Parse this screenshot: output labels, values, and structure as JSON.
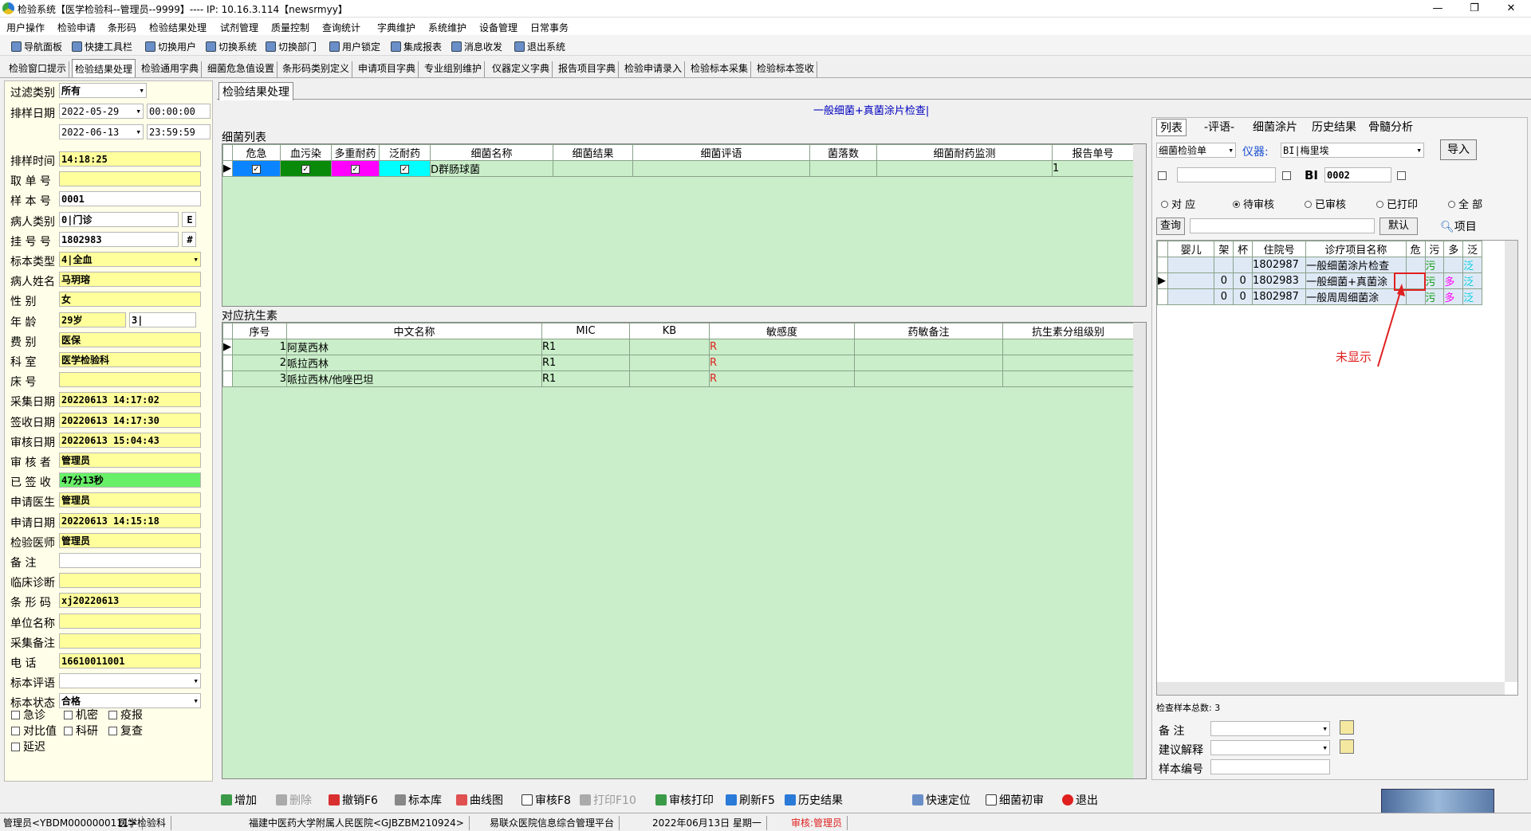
{
  "window": {
    "title": "检验系统【医学检验科--管理员--9999】---- IP: 10.16.3.114【newsrmyy】",
    "minimize": "—",
    "restore": "❐",
    "close": "✕"
  },
  "menu": [
    "用户操作",
    "检验申请",
    "条形码",
    "检验结果处理",
    "试剂管理",
    "质量控制",
    "查询统计",
    "字典维护",
    "系统维护",
    "设备管理",
    "日常事务"
  ],
  "toolbar": [
    "导航面板",
    "快捷工具栏",
    "切换用户",
    "切换系统",
    "切换部门",
    "用户锁定",
    "集成报表",
    "消息收发",
    "退出系统"
  ],
  "tabs": [
    "检验窗口提示",
    "检验结果处理",
    "检验通用字典",
    "细菌危急值设置",
    "条形码类别定义",
    "申请项目字典",
    "专业组别维护",
    "仪器定义字典",
    "报告项目字典",
    "检验申请录入",
    "检验标本采集",
    "检验标本签收"
  ],
  "active_tab": "检验结果处理",
  "left": {
    "filter_label": "过滤类别",
    "filter_value": "所有",
    "date_label": "排样日期",
    "date_from": "2022-05-29",
    "time_from": "00:00:00",
    "date_to": "2022-06-13",
    "time_to": "23:59:59",
    "fields": [
      {
        "label": "排样时间",
        "value": "14:18:25",
        "style": "y"
      },
      {
        "label": "取 单 号",
        "value": "",
        "style": "y"
      },
      {
        "label": "样 本 号",
        "value": "0001",
        "style": "w"
      },
      {
        "label": "病人类别",
        "value": "0|门诊",
        "style": "w",
        "btn": "E"
      },
      {
        "label": "挂 号 号",
        "value": "1802983",
        "style": "w",
        "btn": "#"
      },
      {
        "label": "标本类型",
        "value": "4|全血",
        "style": "y",
        "dd": true
      },
      {
        "label": "病人姓名",
        "value": "马玥瑢",
        "style": "y"
      },
      {
        "label": "性    别",
        "value": "女",
        "style": "y"
      },
      {
        "label": "年    龄",
        "value": "29岁",
        "style": "y",
        "extra": "3|"
      },
      {
        "label": "费    别",
        "value": "医保",
        "style": "y"
      },
      {
        "label": "科    室",
        "value": "医学检验科",
        "style": "y"
      },
      {
        "label": "床    号",
        "value": "",
        "style": "y"
      },
      {
        "label": "采集日期",
        "value": "20220613 14:17:02",
        "style": "y"
      },
      {
        "label": "签收日期",
        "value": "20220613 14:17:30",
        "style": "y"
      },
      {
        "label": "审核日期",
        "value": "20220613 15:04:43",
        "style": "y"
      },
      {
        "label": "审 核 者",
        "value": "管理员",
        "style": "y"
      },
      {
        "label": "已 签 收",
        "value": "47分13秒",
        "style": "g"
      },
      {
        "label": "申请医生",
        "value": "管理员",
        "style": "y"
      },
      {
        "label": "申请日期",
        "value": "20220613 14:15:18",
        "style": "y"
      },
      {
        "label": "检验医师",
        "value": "管理员",
        "style": "y"
      },
      {
        "label": "备    注",
        "value": "",
        "style": "w"
      },
      {
        "label": "临床诊断",
        "value": "",
        "style": "y"
      },
      {
        "label": "条 形 码",
        "value": "xj20220613",
        "style": "y"
      },
      {
        "label": "单位名称",
        "value": "",
        "style": "y"
      },
      {
        "label": "采集备注",
        "value": "",
        "style": "y"
      },
      {
        "label": "电    话",
        "value": "16610011001",
        "style": "y"
      },
      {
        "label": "标本评语",
        "value": "",
        "style": "w",
        "dd": true
      },
      {
        "label": "标本状态",
        "value": "合格",
        "style": "w",
        "dd": true
      }
    ],
    "checks": [
      "急诊",
      "机密",
      "疫报",
      "对比值",
      "科研",
      "复查",
      "延迟"
    ]
  },
  "center": {
    "header_tab": "检验结果处理",
    "test_name": "一般细菌+真菌涂片检查|",
    "bact_title": "细菌列表",
    "bact_cols": [
      "危急",
      "血污染",
      "多重耐药",
      "泛耐药",
      "细菌名称",
      "细菌结果",
      "细菌评语",
      "菌落数",
      "细菌耐药监测",
      "报告单号"
    ],
    "bact_rows": [
      {
        "name": "D群肠球菌",
        "result": "",
        "comment": "",
        "count": "",
        "monitor": "",
        "report": "1",
        "flags": [
          "✓",
          "✓",
          "✓",
          "✓"
        ]
      }
    ],
    "abx_title": "对应抗生素",
    "abx_cols": [
      "序号",
      "中文名称",
      "MIC",
      "KB",
      "敏感度",
      "药敏备注",
      "抗生素分组级别"
    ],
    "abx_rows": [
      {
        "no": "1",
        "name": "阿莫西林",
        "mic": "R1",
        "kb": "",
        "sens": "R"
      },
      {
        "no": "2",
        "name": "哌拉西林",
        "mic": "R1",
        "kb": "",
        "sens": "R"
      },
      {
        "no": "3",
        "name": "哌拉西林/他唑巴坦",
        "mic": "R1",
        "kb": "",
        "sens": "R"
      }
    ]
  },
  "right": {
    "tabs": [
      "列表",
      "-评语-",
      "细菌涂片",
      "历史结果",
      "骨髓分析"
    ],
    "doc_type": "细菌检验单",
    "instrument_label": "仪器:",
    "instrument": "BI|梅里埃",
    "import": "导入",
    "bi_label": "BI",
    "bi_value": "0002",
    "radios": [
      "对 应",
      "待审核",
      "已审核",
      "已打印",
      "全 部"
    ],
    "query": "查询",
    "default": "默认",
    "item": "项目",
    "cols": [
      "婴儿",
      "架",
      "杯",
      "住院号",
      "诊疗项目名称",
      "危",
      "污",
      "多",
      "泛"
    ],
    "rows": [
      {
        "infant": "",
        "rack": "",
        "cup": "",
        "id": "1802987",
        "item": "一般细菌涂片检查",
        "w": "",
        "p": "污",
        "m": "",
        "f": "泛"
      },
      {
        "infant": "",
        "rack": "0",
        "cup": "0",
        "id": "1802983",
        "item": "一般细菌+真菌涂",
        "w": "",
        "p": "污",
        "m": "多",
        "f": "泛"
      },
      {
        "infant": "",
        "rack": "0",
        "cup": "0",
        "id": "1802987",
        "item": "一般周周细菌涂",
        "w": "",
        "p": "污",
        "m": "多",
        "f": "泛"
      }
    ],
    "annotation": "未显示",
    "total": "检查样本总数: 3",
    "remark": "备    注",
    "advice": "建议解释",
    "sample_no": "样本编号"
  },
  "bottom": [
    "增加",
    "删除",
    "撤销F6",
    "标本库",
    "曲线图",
    "审核F8",
    "打印F10",
    "审核打印",
    "刷新F5",
    "历史结果",
    "快速定位",
    "细菌初审",
    "退出"
  ],
  "status": [
    "管理员<YBDM0000000111>",
    "医学检验科",
    "福建中医药大学附属人民医院<GJBZBM210924>",
    "易联众医院信息综合管理平台",
    "2022年06月13日 星期一",
    "审核:管理员"
  ],
  "colors": {
    "danger": "#0b84ff",
    "blood": "#0a8a0a",
    "multi": "#ff00ff",
    "pan": "#00ffff",
    "grid": "#c9eec9",
    "field": "#ffff9c"
  }
}
